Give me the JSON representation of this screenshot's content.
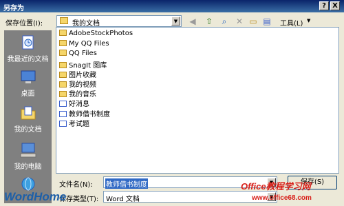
{
  "window": {
    "title": "另存为",
    "help_glyph": "?",
    "close_glyph": "X"
  },
  "toolbar": {
    "location_label": "保存位置(I):",
    "location_value": "我的文档",
    "tools_label": "工具(L)"
  },
  "places": [
    {
      "label": "我最近的文档",
      "icon": "recent-docs-icon"
    },
    {
      "label": "桌面",
      "icon": "desktop-icon"
    },
    {
      "label": "我的文档",
      "icon": "my-documents-icon"
    },
    {
      "label": "我的电脑",
      "icon": "my-computer-icon"
    }
  ],
  "files": [
    {
      "name": "AdobeStockPhotos",
      "type": "folder"
    },
    {
      "name": "My QQ Files",
      "type": "folder"
    },
    {
      "name": "QQ Files",
      "type": "folder"
    },
    {
      "name": "SnagIt 图库",
      "type": "folder"
    },
    {
      "name": "图片收藏",
      "type": "folder"
    },
    {
      "name": "我的视频",
      "type": "folder"
    },
    {
      "name": "我的音乐",
      "type": "folder"
    },
    {
      "name": "好消息",
      "type": "doc"
    },
    {
      "name": "教师借书制度",
      "type": "doc"
    },
    {
      "name": "考试题",
      "type": "doc"
    }
  ],
  "form": {
    "filename_label": "文件名(N):",
    "filename_value": "教师借书制度",
    "filetype_label": "保存类型(T):",
    "filetype_value": "Word 文档",
    "save_label": "保存(S)"
  },
  "watermarks": {
    "left": "WordHome",
    "right_top": "Office教程学习网",
    "right_bottom": "www.office68.com"
  },
  "colors": {
    "title_start": "#0a246a",
    "title_end": "#3a6ea5",
    "dialog_bg": "#ece9d8",
    "selection": "#316ac5"
  }
}
